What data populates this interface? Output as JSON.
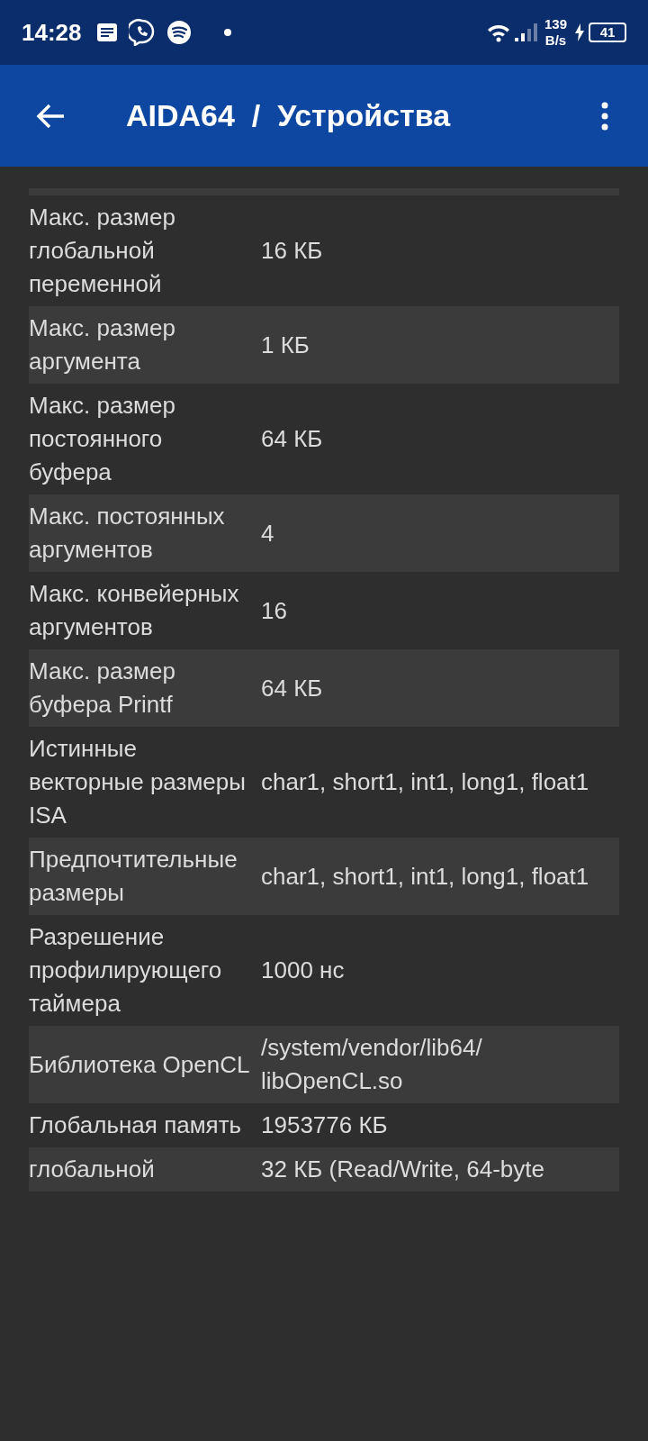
{
  "status_bar": {
    "time": "14:28",
    "net_speed_value": "139",
    "net_speed_unit": "B/s",
    "battery": "41"
  },
  "app_bar": {
    "title": "AIDA64  /  Устройства"
  },
  "rows": [
    {
      "label": "Макс. размер глобальной переменной",
      "value": "16 КБ"
    },
    {
      "label": "Макс. размер аргумента",
      "value": "1 КБ"
    },
    {
      "label": "Макс. размер постоянного буфера",
      "value": "64 КБ"
    },
    {
      "label": "Макс. постоянных аргументов",
      "value": "4"
    },
    {
      "label": "Макс. конвейерных аргументов",
      "value": "16"
    },
    {
      "label": "Макс. размер буфера Printf",
      "value": "64 КБ"
    },
    {
      "label": "Истинные векторные размеры ISA",
      "value": "char1, short1, int1, long1, float1"
    },
    {
      "label": "Предпочтительные размеры",
      "value": "char1, short1, int1, long1, float1"
    },
    {
      "label": "Разрешение профилирующего таймера",
      "value": "1000 нс"
    },
    {
      "label": "Библиотека OpenCL",
      "value": "/system/vendor/lib64/ libOpenCL.so"
    },
    {
      "label": "Глобальная память",
      "value": "1953776 КБ"
    },
    {
      "label": "глобальной",
      "value": "32 КБ (Read/Write, 64-byte"
    }
  ]
}
